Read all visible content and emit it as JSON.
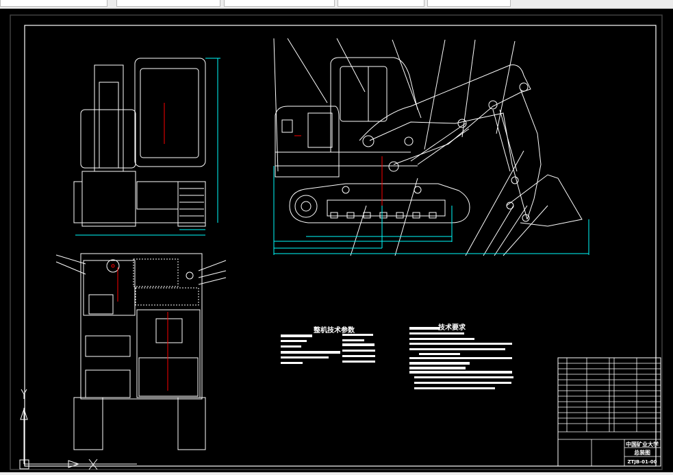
{
  "toolbar": {
    "fields": [
      "",
      "",
      "",
      "",
      ""
    ]
  },
  "colors": {
    "background": "#000000",
    "lines": "#ffffff",
    "dimensions": "#00ffff",
    "dimension_text": "#00ff00",
    "centerlines": "#ff0000",
    "frame": "#404040"
  },
  "drawing": {
    "params_table": {
      "title": "整机技术参数"
    },
    "tech_requirements": {
      "title": "技术要求"
    },
    "title_block": {
      "organization": "中国矿业大学",
      "drawing_name": "总装图",
      "drawing_number": "ZTJB-01-00"
    }
  },
  "ucs_icon": {
    "x_axis": "X",
    "y_axis": "Y"
  }
}
